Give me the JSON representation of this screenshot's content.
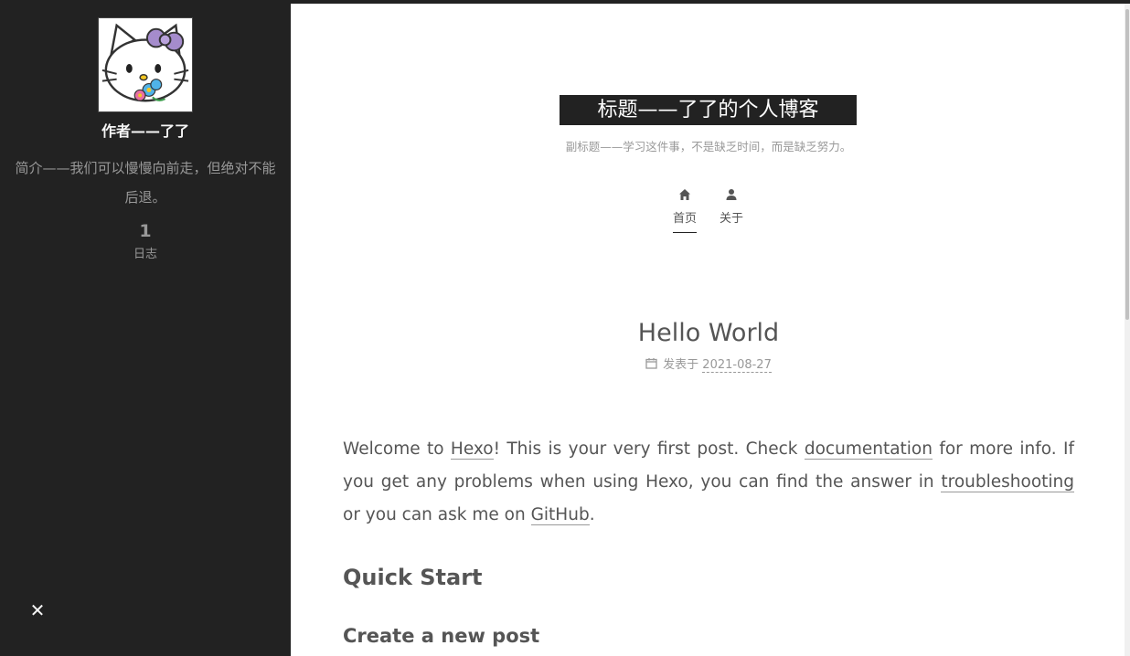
{
  "sidebar": {
    "avatar_alt": "Hello Kitty avatar",
    "author": "作者——了了",
    "description": "简介——我们可以慢慢向前走，但绝对不能后退。",
    "stats": {
      "posts_count": "1",
      "posts_label": "日志"
    },
    "close_icon": "close-icon",
    "close_glyph": "✕"
  },
  "header": {
    "title": "标题——了了的个人博客",
    "subtitle": "副标题——学习这件事，不是缺乏时间，而是缺乏努力。"
  },
  "nav": {
    "items": [
      {
        "label": "首页",
        "icon": "home-icon",
        "active": true
      },
      {
        "label": "关于",
        "icon": "user-icon",
        "active": false
      }
    ]
  },
  "post": {
    "title": "Hello World",
    "meta_prefix": "发表于",
    "date": "2021-08-27",
    "body": {
      "t1": "Welcome to ",
      "link_hexo": "Hexo",
      "t2": "! This is your very first post. Check ",
      "link_docs": "documentation",
      "t3": " for more info. If you get any problems when using Hexo, you can find the answer in ",
      "link_trouble": "troubleshooting",
      "t4": " or you can ask me on ",
      "link_github": "GitHub",
      "t5": "."
    },
    "h2_quick_start": "Quick Start",
    "h3_create_post": "Create a new post"
  },
  "colors": {
    "sidebar_bg": "#222222",
    "text": "#555555",
    "muted": "#999999"
  }
}
